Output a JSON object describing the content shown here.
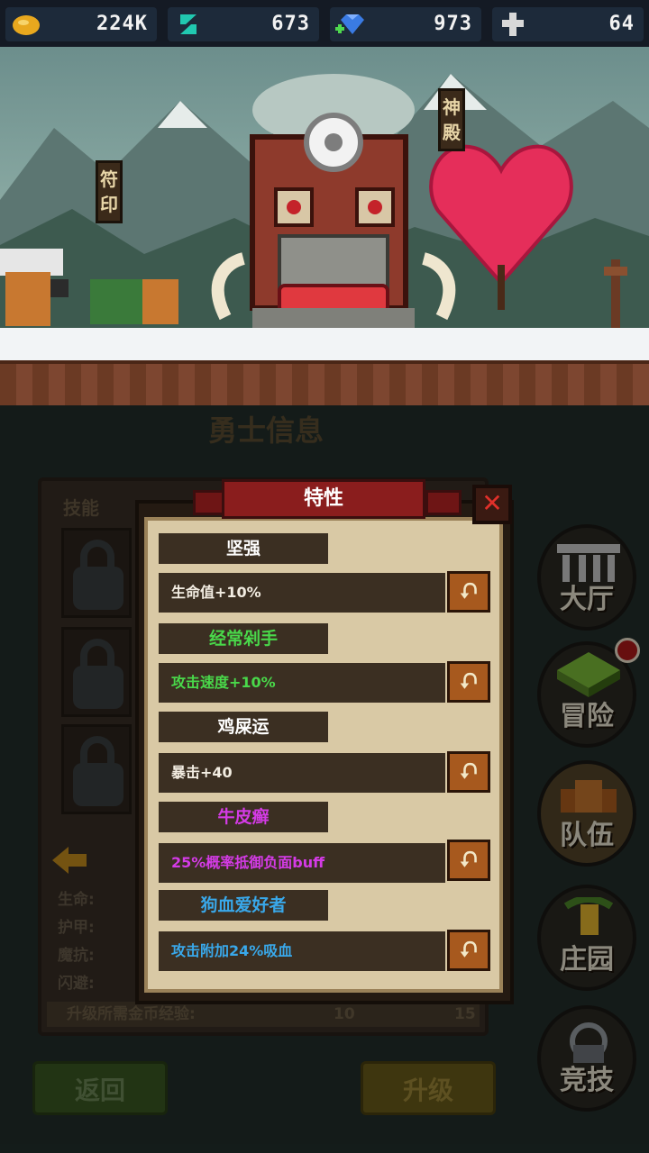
{
  "resources": [
    {
      "icon": "gold-icon",
      "value": "224K"
    },
    {
      "icon": "soul-gem-icon",
      "value": "673"
    },
    {
      "icon": "diamond-icon",
      "value": "973"
    },
    {
      "icon": "cross-token-icon",
      "value": "64"
    }
  ],
  "scene": {
    "sign_left": "符印",
    "sign_right": "神殿"
  },
  "panel": {
    "title": "勇士信息",
    "skills_label": "技能",
    "stats": [
      "生命:",
      "护甲:",
      "魔抗:",
      "闪避:"
    ],
    "upgrade_cost_label": "升级所需金币经验:",
    "upgrade_cost_gold": "10",
    "upgrade_cost_gem": "15",
    "back_button": "返回",
    "upgrade_button": "升级"
  },
  "nav": [
    {
      "label": "大厅",
      "icon": "hall-icon"
    },
    {
      "label": "冒险",
      "icon": "adventure-icon"
    },
    {
      "label": "队伍",
      "icon": "team-icon"
    },
    {
      "label": "庄园",
      "icon": "manor-icon"
    },
    {
      "label": "竞技",
      "icon": "arena-icon"
    }
  ],
  "dialog": {
    "title": "特性",
    "close_symbol": "✕",
    "swap_symbol": "⮏",
    "traits": [
      {
        "name": "坚强",
        "name_color": "#ffffff",
        "desc": "生命值+10%",
        "desc_color": "#f3ede2"
      },
      {
        "name": "经常剁手",
        "name_color": "#49d84a",
        "desc": "攻击速度+10%",
        "desc_color": "#49d84a"
      },
      {
        "name": "鸡屎运",
        "name_color": "#ffffff",
        "desc": "暴击+40",
        "desc_color": "#f3ede2"
      },
      {
        "name": "牛皮癣",
        "name_color": "#d43be6",
        "desc": "25%概率抵御负面buff",
        "desc_color": "#d43be6"
      },
      {
        "name": "狗血爱好者",
        "name_color": "#39a8ea",
        "desc": "攻击附加24%吸血",
        "desc_color": "#39a8ea"
      }
    ]
  }
}
